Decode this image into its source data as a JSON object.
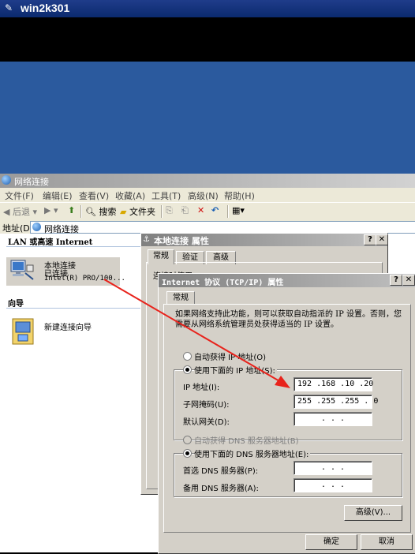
{
  "rdp": {
    "title": "win2k301"
  },
  "explorer": {
    "title": "网络连接",
    "menu": [
      "文件(F)",
      "编辑(E)",
      "查看(V)",
      "收藏(A)",
      "工具(T)",
      "高级(N)",
      "帮助(H)"
    ],
    "toolbar": {
      "back": "后退",
      "search": "搜索",
      "folders": "文件夹"
    },
    "address_label": "地址(D)",
    "address_value": "网络连接",
    "group_lan": "LAN 或高速 Internet",
    "lan_item": {
      "name": "本地连接",
      "status": "已连接",
      "adapter": "Intel(R) PRO/100..."
    },
    "group_wizard": "向导",
    "wizard_item": "新建连接向导"
  },
  "props_dialog": {
    "title": "本地连接 属性",
    "tabs": [
      "常规",
      "验证",
      "高级"
    ],
    "partial_label": "连接时使用："
  },
  "tcpip_dialog": {
    "title": "Internet 协议 (TCP/IP) 属性",
    "tab": "常规",
    "description": "如果网络支持此功能，则可以获取自动指派的 IP 设置。否则，您需要从网络系统管理员处获得适当的 IP 设置。",
    "auto_ip": "自动获得 IP 地址(O)",
    "manual_ip": "使用下面的 IP 地址(S):",
    "ip_label": "IP 地址(I):",
    "ip_value": "192 .168 .10 .20",
    "mask_label": "子网掩码(U):",
    "mask_value": "255 .255 .255 . 0",
    "gateway_label": "默认网关(D):",
    "gateway_value": ".     .     .",
    "auto_dns": "自动获得 DNS 服务器地址(B)",
    "manual_dns": "使用下面的 DNS 服务器地址(E):",
    "dns1_label": "首选 DNS 服务器(P):",
    "dns1_value": ".     .     .",
    "dns2_label": "备用 DNS 服务器(A):",
    "dns2_value": ".     .     .",
    "advanced_button": "高级(V)...",
    "ok_button": "确定",
    "cancel_button": "取消",
    "help_button": "?",
    "close_button": "✕"
  },
  "colors": {
    "annotation_arrow": "#e8231c",
    "desktop": "#2b5a9e"
  }
}
